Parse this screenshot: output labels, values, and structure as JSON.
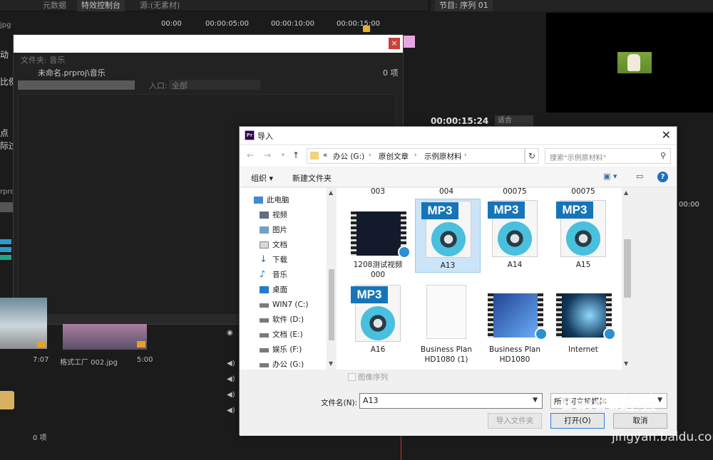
{
  "premiere": {
    "top_tabs": [
      "元数据",
      "特效控制台",
      "源:(无素材)"
    ],
    "monitor_tab": "节目: 序列 01",
    "ruler_marks": [
      "00:00",
      "00:00:05:00",
      "00:00:10:00",
      "00:00:15:00"
    ],
    "timecode": "00:00:15:24",
    "fit_label": "适合",
    "left_labels": [
      "jpg",
      "动",
      "比例",
      "点",
      "际过",
      "rpro"
    ],
    "right_time": "00:00",
    "music_panel": {
      "tab": "文件夹: 音乐",
      "path": "未命名.prproj\\音乐",
      "count": "0 项",
      "in_label": "入口:",
      "in_value": "全部"
    },
    "thumb1_duration": "7:07",
    "thumb2_name": "格式工厂 002.jpg",
    "thumb2_duration": "5:00",
    "bottom_count": "0 项"
  },
  "dialog": {
    "title": "导入",
    "breadcrumb": [
      "«",
      "办公 (G:)",
      "原创文章",
      "示例原材料"
    ],
    "search_placeholder": "搜索\"示例原材料\"",
    "toolbar": {
      "organize": "组织 ▾",
      "new_folder": "新建文件夹"
    },
    "tree": [
      {
        "label": "此电脑",
        "icon": "computer-icon"
      },
      {
        "label": "视频",
        "icon": "video-folder-icon"
      },
      {
        "label": "图片",
        "icon": "pictures-folder-icon"
      },
      {
        "label": "文档",
        "icon": "documents-folder-icon"
      },
      {
        "label": "下载",
        "icon": "download-icon"
      },
      {
        "label": "音乐",
        "icon": "music-icon"
      },
      {
        "label": "桌面",
        "icon": "desktop-icon"
      },
      {
        "label": "WIN7 (C:)",
        "icon": "drive-icon"
      },
      {
        "label": "软件 (D:)",
        "icon": "drive-icon"
      },
      {
        "label": "文档 (E:)",
        "icon": "drive-icon"
      },
      {
        "label": "娱乐 (F:)",
        "icon": "drive-icon"
      },
      {
        "label": "办公 (G:)",
        "icon": "drive-icon"
      }
    ],
    "partial_row_labels": [
      "003",
      "004",
      "00075",
      "00075"
    ],
    "files": [
      {
        "label": "1208测试视频 000",
        "kind": "video"
      },
      {
        "label": "A13",
        "kind": "mp3",
        "selected": true
      },
      {
        "label": "A14",
        "kind": "mp3"
      },
      {
        "label": "A15",
        "kind": "mp3"
      },
      {
        "label": "A16",
        "kind": "mp3"
      },
      {
        "label": "Business Plan HD1080 (1)",
        "kind": "blank"
      },
      {
        "label": "Business Plan HD1080",
        "kind": "video"
      },
      {
        "label": "Internet",
        "kind": "video"
      }
    ],
    "mp3_tag": "MP3",
    "image_sequence": "图像序列",
    "filename_label": "文件名(N):",
    "filename_value": "A13",
    "filetype_value": "所有可支持媒体",
    "import_folder_button": "导入文件夹",
    "open_button": "打开(O)",
    "cancel_button": "取消"
  },
  "watermark": {
    "logo": "Baidu经验",
    "url": "jingyan.baidu.com"
  }
}
